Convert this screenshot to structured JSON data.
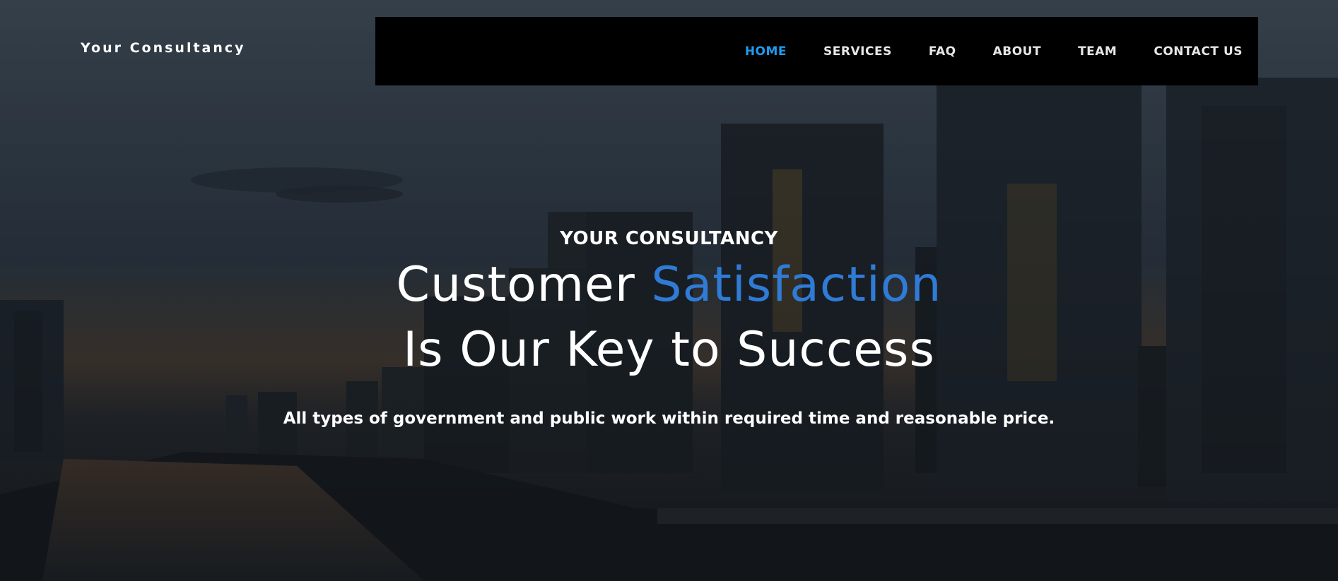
{
  "brand": {
    "name": "Your Consultancy"
  },
  "nav": {
    "items": [
      {
        "label": "HOME",
        "active": true
      },
      {
        "label": "SERVICES",
        "active": false
      },
      {
        "label": "FAQ",
        "active": false
      },
      {
        "label": "ABOUT",
        "active": false
      },
      {
        "label": "TEAM",
        "active": false
      },
      {
        "label": "CONTACT US",
        "active": false
      }
    ]
  },
  "hero": {
    "eyebrow": "YOUR CONSULTANCY",
    "headline_part1": "Customer",
    "headline_accent": "Satisfaction",
    "headline_line2": "Is Our Key to Success",
    "subtitle": "All types of government and public work within required time and reasonable price."
  },
  "colors": {
    "nav_background": "#000000",
    "nav_active": "#1f9bf0",
    "headline_accent": "#2f7bd6",
    "text": "#ffffff"
  },
  "images": {
    "hero_background": "city-skyline-at-dusk"
  }
}
